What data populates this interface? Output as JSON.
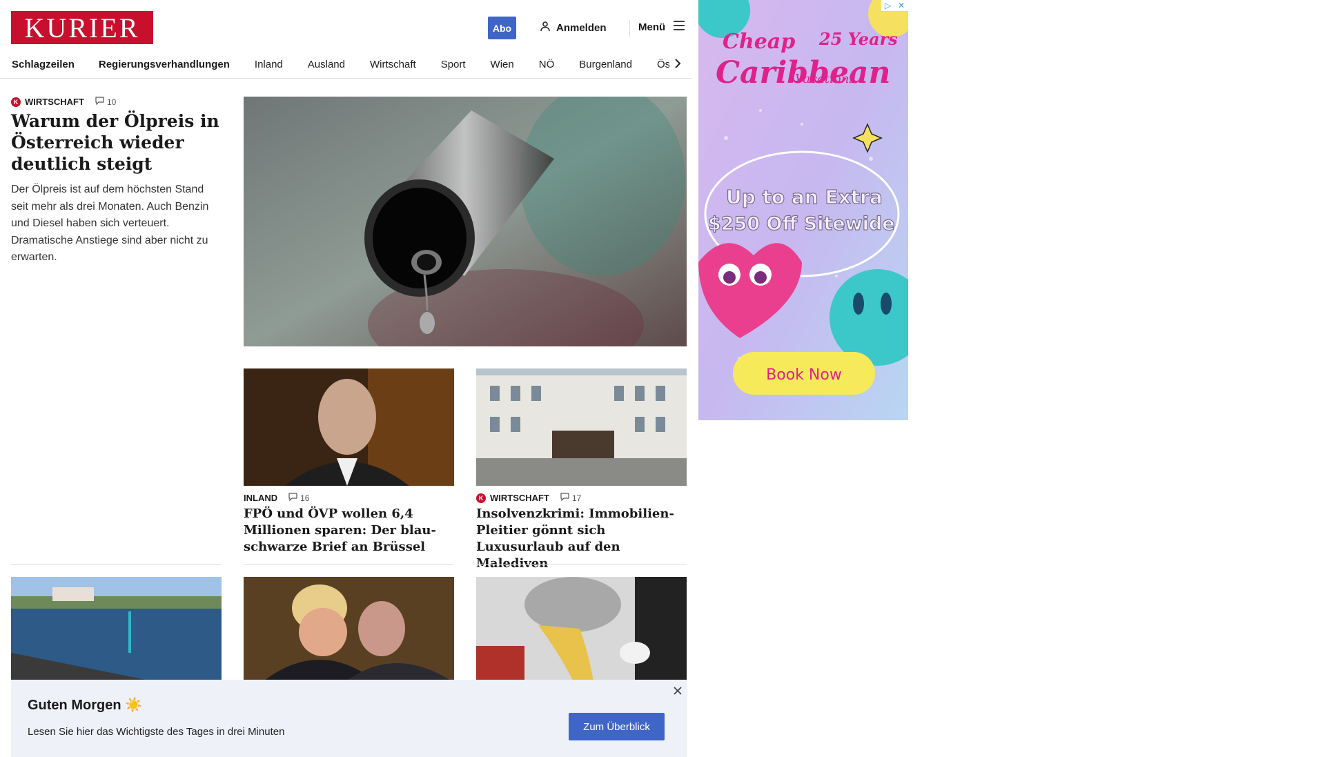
{
  "header": {
    "logo": "KURIER",
    "abo": "Abo",
    "login": "Anmelden",
    "menu": "Menü"
  },
  "nav": {
    "items": [
      "Schlagzeilen",
      "Regierungsverhandlungen",
      "Inland",
      "Ausland",
      "Wirtschaft",
      "Sport",
      "Wien",
      "NÖ",
      "Burgenland",
      "Österreich"
    ]
  },
  "lead": {
    "category": "WIRTSCHAFT",
    "comments": "10",
    "title": "Warum der Ölpreis in Ös­terreich wieder deutlich steigt",
    "teaser": "Der Ölpreis ist auf dem höchsten Stand seit mehr als drei Monaten. Auch Benzin und Diesel haben sich verteuert. Dramatische Anstiege sind aber nicht zu erwarten."
  },
  "cards": [
    {
      "category": "INLAND",
      "comments": "16",
      "title": "FPÖ und ÖVP wollen 6,4 Millionen sparen: Der blau-schwarze Brief an Brüssel"
    },
    {
      "category": "WIRTSCHAFT",
      "comments": "17",
      "title": "Insolvenzkrimi: Immobilien-Plei­tier gönnt sich Luxusurlaub auf den Malediven"
    }
  ],
  "ad": {
    "headline_1": "Cheap",
    "headline_2": "Caribbean",
    "headline_3": "Vacations",
    "years": "25 Years",
    "offer_1": "Up to an Extra",
    "offer_2": "$250 Off Sitewide",
    "cta": "Book Now"
  },
  "banner": {
    "title": "Guten Morgen ☀️",
    "text": "Lesen Sie hier das Wichtigste des Tages in drei Minuten",
    "button": "Zum Überblick"
  },
  "colors": {
    "brand_red": "#c8102e",
    "accent_blue": "#3f66c7",
    "banner_bg": "#eef1f8"
  }
}
